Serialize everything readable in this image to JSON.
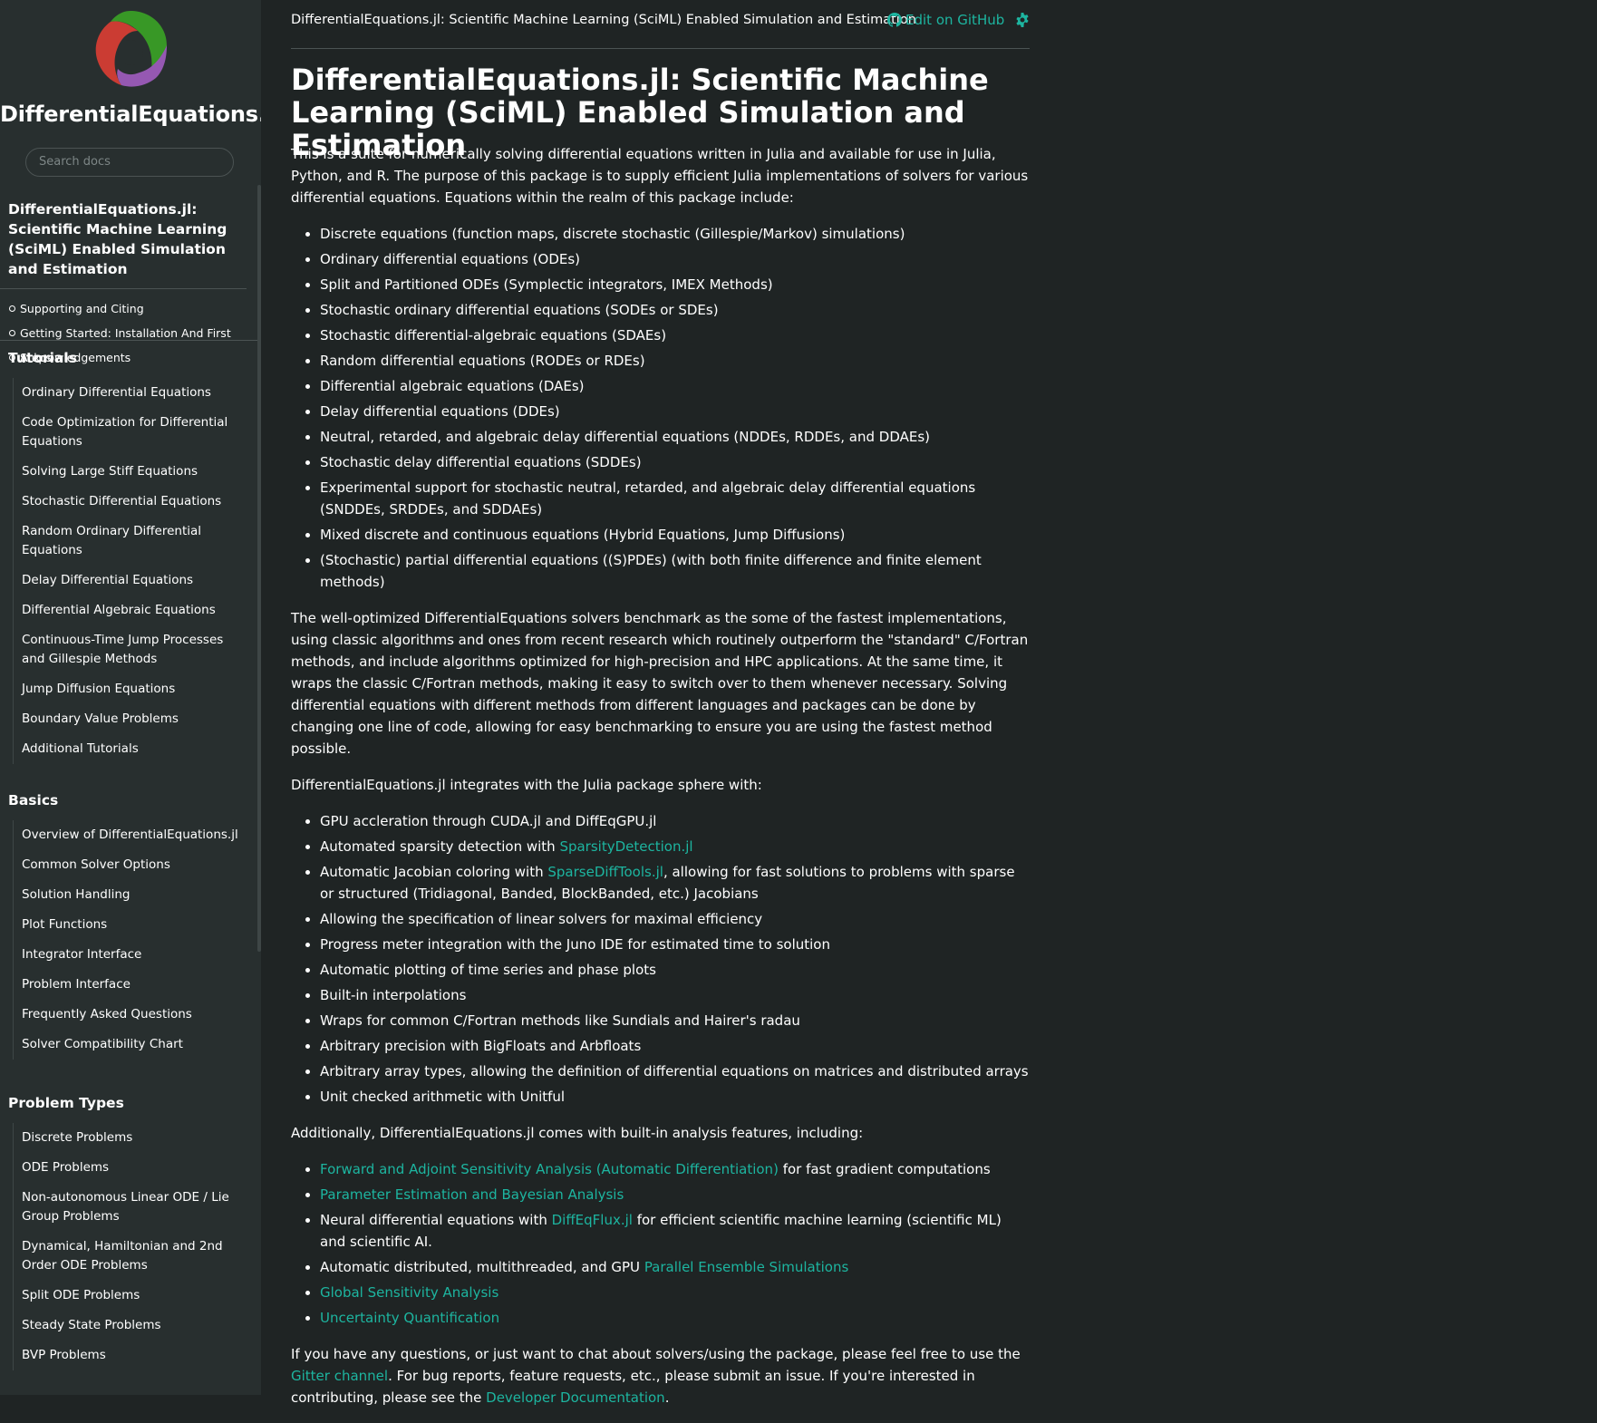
{
  "sidebar": {
    "site_title": "DifferentialEquations.jl",
    "search_placeholder": "Search docs",
    "current_page": "DifferentialEquations.jl: Scientific Machine Learning (SciML) Enabled Simulation and Estimation",
    "toc": [
      "Supporting and Citing",
      "Getting Started: Installation And First Steps",
      "Acknowledgements"
    ],
    "sections": [
      {
        "title": "Tutorials",
        "items": [
          "Ordinary Differential Equations",
          "Code Optimization for Differential Equations",
          "Solving Large Stiff Equations",
          "Stochastic Differential Equations",
          "Random Ordinary Differential Equations",
          "Delay Differential Equations",
          "Differential Algebraic Equations",
          "Continuous-Time Jump Processes and Gillespie Methods",
          "Jump Diffusion Equations",
          "Boundary Value Problems",
          "Additional Tutorials"
        ]
      },
      {
        "title": "Basics",
        "items": [
          "Overview of DifferentialEquations.jl",
          "Common Solver Options",
          "Solution Handling",
          "Plot Functions",
          "Integrator Interface",
          "Problem Interface",
          "Frequently Asked Questions",
          "Solver Compatibility Chart"
        ]
      },
      {
        "title": "Problem Types",
        "items": [
          "Discrete Problems",
          "ODE Problems",
          "Non-autonomous Linear ODE / Lie Group Problems",
          "Dynamical, Hamiltonian and 2nd Order ODE Problems",
          "Split ODE Problems",
          "Steady State Problems",
          "BVP Problems"
        ]
      }
    ]
  },
  "topbar": {
    "breadcrumb": "DifferentialEquations.jl: Scientific Machine Learning (SciML) Enabled Simulation and Estimation",
    "edit_label": "Edit on GitHub",
    "gear_icon": "gear-icon",
    "github_icon": "github-icon"
  },
  "main": {
    "title": "DifferentialEquations.jl: Scientific Machine Learning (SciML) Enabled Simulation and Estimation",
    "intro": "This is a suite for numerically solving differential equations written in Julia and available for use in Julia, Python, and R. The purpose of this package is to supply efficient Julia implementations of solvers for various differential equations. Equations within the realm of this package include:",
    "equation_types": [
      "Discrete equations (function maps, discrete stochastic (Gillespie/Markov) simulations)",
      "Ordinary differential equations (ODEs)",
      "Split and Partitioned ODEs (Symplectic integrators, IMEX Methods)",
      "Stochastic ordinary differential equations (SODEs or SDEs)",
      "Stochastic differential-algebraic equations (SDAEs)",
      "Random differential equations (RODEs or RDEs)",
      "Differential algebraic equations (DAEs)",
      "Delay differential equations (DDEs)",
      "Neutral, retarded, and algebraic delay differential equations (NDDEs, RDDEs, and DDAEs)",
      "Stochastic delay differential equations (SDDEs)",
      "Experimental support for stochastic neutral, retarded, and algebraic delay differential equations (SNDDEs, SRDDEs, and SDDAEs)",
      "Mixed discrete and continuous equations (Hybrid Equations, Jump Diffusions)",
      "(Stochastic) partial differential equations ((S)PDEs) (with both finite difference and finite element methods)"
    ],
    "performance": "The well-optimized DifferentialEquations solvers benchmark as the some of the fastest implementations, using classic algorithms and ones from recent research which routinely outperform the \"standard\" C/Fortran methods, and include algorithms optimized for high-precision and HPC applications. At the same time, it wraps the classic C/Fortran methods, making it easy to switch over to them whenever necessary. Solving differential equations with different methods from different languages and packages can be done by changing one line of code, allowing for easy benchmarking to ensure you are using the fastest method possible.",
    "integrates_intro": "DifferentialEquations.jl integrates with the Julia package sphere with:",
    "integrations": {
      "gpu": "GPU accleration through CUDA.jl and DiffEqGPU.jl",
      "sparsity_prefix": "Automated sparsity detection with ",
      "sparsity_link": "SparsityDetection.jl",
      "jacobian_prefix": "Automatic Jacobian coloring with ",
      "jacobian_link": "SparseDiffTools.jl",
      "jacobian_suffix": ", allowing for fast solutions to problems with sparse or structured (Tridiagonal, Banded, BlockBanded, etc.) Jacobians",
      "linear": "Allowing the specification of linear solvers for maximal efficiency",
      "progress": "Progress meter integration with the Juno IDE for estimated time to solution",
      "plotting": "Automatic plotting of time series and phase plots",
      "interp": "Built-in interpolations",
      "wraps": "Wraps for common C/Fortran methods like Sundials and Hairer's radau",
      "precision": "Arbitrary precision with BigFloats and Arbfloats",
      "arrays": "Arbitrary array types, allowing the definition of differential equations on matrices and distributed arrays",
      "units": "Unit checked arithmetic with Unitful"
    },
    "analysis_intro": "Additionally, DifferentialEquations.jl comes with built-in analysis features, including:",
    "analysis": {
      "sensitivity_link": "Forward and Adjoint Sensitivity Analysis (Automatic Differentiation)",
      "sensitivity_suffix": " for fast gradient computations",
      "param_link": "Parameter Estimation and Bayesian Analysis",
      "neural_prefix": "Neural differential equations with ",
      "neural_link": "DiffEqFlux.jl",
      "neural_suffix": " for efficient scientific machine learning (scientific ML) and scientific AI.",
      "parallel_prefix": "Automatic distributed, multithreaded, and GPU ",
      "parallel_link": "Parallel Ensemble Simulations",
      "gsa_link": "Global Sensitivity Analysis",
      "uq_link": "Uncertainty Quantification"
    },
    "closing": {
      "prefix": "If you have any questions, or just want to chat about solvers/using the package, please feel free to use the ",
      "gitter_link": "Gitter channel",
      "middle": ". For bug reports, feature requests, etc., please submit an issue. If you're interested in contributing, please see the ",
      "dev_link": "Developer Documentation",
      "suffix": "."
    }
  },
  "colors": {
    "background": "#1f2424",
    "sidebar": "#282f2f",
    "link": "#1db5a0",
    "text": "#ffffff"
  }
}
